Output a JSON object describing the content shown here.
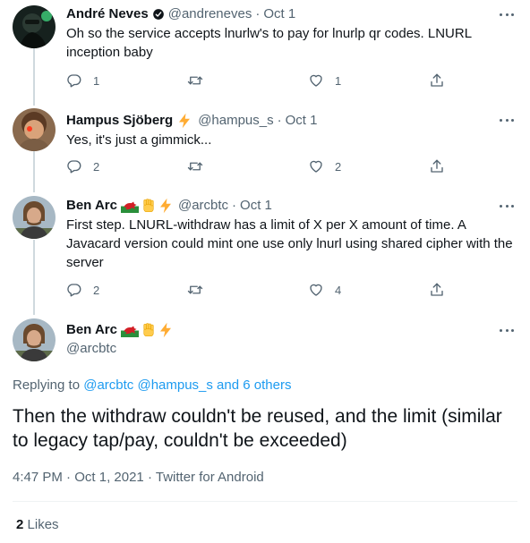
{
  "tweets": [
    {
      "name": "André Neves",
      "handle": "@andreneves",
      "date": "Oct 1",
      "text": "Oh so the service accepts lnurlw's to pay for lnurlp qr codes. LNURL inception baby",
      "replies": "1",
      "retweets": "",
      "likes": "1"
    },
    {
      "name": "Hampus Sjöberg",
      "handle": "@hampus_s",
      "date": "Oct 1",
      "text": "Yes, it's just a gimmick...",
      "replies": "2",
      "retweets": "",
      "likes": "2"
    },
    {
      "name": "Ben Arc",
      "handle": "@arcbtc",
      "date": "Oct 1",
      "text": "First step. LNURL-withdraw has a limit of X per X amount of time. A Javacard version could mint one use only lnurl using shared cipher with the server",
      "replies": "2",
      "retweets": "",
      "likes": "4"
    }
  ],
  "focus": {
    "name": "Ben Arc",
    "handle": "@arcbtc",
    "replying_prefix": "Replying to",
    "replying_to": "@arcbtc @hampus_s and 6 others",
    "text": "Then the withdraw couldn't be reused, and the limit (similar to legacy tap/pay, couldn't be exceeded)",
    "time": "4:47 PM",
    "date": "Oct 1, 2021",
    "source": "Twitter for Android",
    "likes_count": "2",
    "likes_label": "Likes"
  },
  "separator": "·",
  "icons": {
    "reply": "reply-icon",
    "retweet": "retweet-icon",
    "like": "heart-icon",
    "share": "share-icon",
    "more": "more-icon",
    "verified": "verified-badge-icon",
    "lightning": "lightning-emoji",
    "wales_flag": "wales-flag-emoji",
    "fist": "raised-fist-emoji"
  },
  "colors": {
    "text": "#0f1419",
    "muted": "#536471",
    "link": "#1d9bf0",
    "thread_line": "#cfd9de",
    "lightning": "#ffac33"
  }
}
